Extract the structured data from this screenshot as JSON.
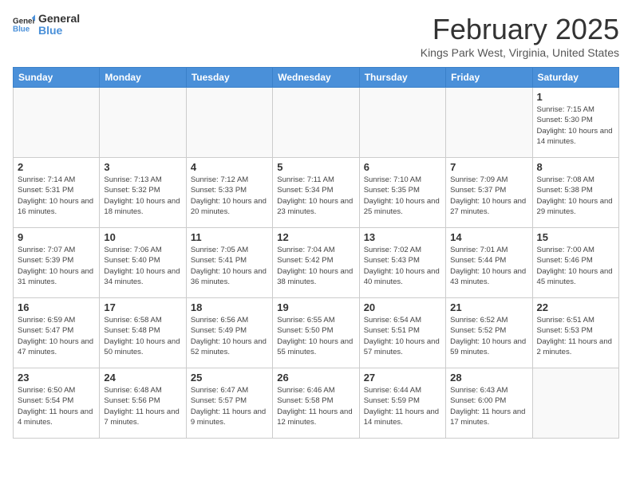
{
  "header": {
    "logo_line1": "General",
    "logo_line2": "Blue",
    "month_title": "February 2025",
    "location": "Kings Park West, Virginia, United States"
  },
  "weekdays": [
    "Sunday",
    "Monday",
    "Tuesday",
    "Wednesday",
    "Thursday",
    "Friday",
    "Saturday"
  ],
  "weeks": [
    [
      {
        "day": "",
        "info": ""
      },
      {
        "day": "",
        "info": ""
      },
      {
        "day": "",
        "info": ""
      },
      {
        "day": "",
        "info": ""
      },
      {
        "day": "",
        "info": ""
      },
      {
        "day": "",
        "info": ""
      },
      {
        "day": "1",
        "info": "Sunrise: 7:15 AM\nSunset: 5:30 PM\nDaylight: 10 hours and 14 minutes."
      }
    ],
    [
      {
        "day": "2",
        "info": "Sunrise: 7:14 AM\nSunset: 5:31 PM\nDaylight: 10 hours and 16 minutes."
      },
      {
        "day": "3",
        "info": "Sunrise: 7:13 AM\nSunset: 5:32 PM\nDaylight: 10 hours and 18 minutes."
      },
      {
        "day": "4",
        "info": "Sunrise: 7:12 AM\nSunset: 5:33 PM\nDaylight: 10 hours and 20 minutes."
      },
      {
        "day": "5",
        "info": "Sunrise: 7:11 AM\nSunset: 5:34 PM\nDaylight: 10 hours and 23 minutes."
      },
      {
        "day": "6",
        "info": "Sunrise: 7:10 AM\nSunset: 5:35 PM\nDaylight: 10 hours and 25 minutes."
      },
      {
        "day": "7",
        "info": "Sunrise: 7:09 AM\nSunset: 5:37 PM\nDaylight: 10 hours and 27 minutes."
      },
      {
        "day": "8",
        "info": "Sunrise: 7:08 AM\nSunset: 5:38 PM\nDaylight: 10 hours and 29 minutes."
      }
    ],
    [
      {
        "day": "9",
        "info": "Sunrise: 7:07 AM\nSunset: 5:39 PM\nDaylight: 10 hours and 31 minutes."
      },
      {
        "day": "10",
        "info": "Sunrise: 7:06 AM\nSunset: 5:40 PM\nDaylight: 10 hours and 34 minutes."
      },
      {
        "day": "11",
        "info": "Sunrise: 7:05 AM\nSunset: 5:41 PM\nDaylight: 10 hours and 36 minutes."
      },
      {
        "day": "12",
        "info": "Sunrise: 7:04 AM\nSunset: 5:42 PM\nDaylight: 10 hours and 38 minutes."
      },
      {
        "day": "13",
        "info": "Sunrise: 7:02 AM\nSunset: 5:43 PM\nDaylight: 10 hours and 40 minutes."
      },
      {
        "day": "14",
        "info": "Sunrise: 7:01 AM\nSunset: 5:44 PM\nDaylight: 10 hours and 43 minutes."
      },
      {
        "day": "15",
        "info": "Sunrise: 7:00 AM\nSunset: 5:46 PM\nDaylight: 10 hours and 45 minutes."
      }
    ],
    [
      {
        "day": "16",
        "info": "Sunrise: 6:59 AM\nSunset: 5:47 PM\nDaylight: 10 hours and 47 minutes."
      },
      {
        "day": "17",
        "info": "Sunrise: 6:58 AM\nSunset: 5:48 PM\nDaylight: 10 hours and 50 minutes."
      },
      {
        "day": "18",
        "info": "Sunrise: 6:56 AM\nSunset: 5:49 PM\nDaylight: 10 hours and 52 minutes."
      },
      {
        "day": "19",
        "info": "Sunrise: 6:55 AM\nSunset: 5:50 PM\nDaylight: 10 hours and 55 minutes."
      },
      {
        "day": "20",
        "info": "Sunrise: 6:54 AM\nSunset: 5:51 PM\nDaylight: 10 hours and 57 minutes."
      },
      {
        "day": "21",
        "info": "Sunrise: 6:52 AM\nSunset: 5:52 PM\nDaylight: 10 hours and 59 minutes."
      },
      {
        "day": "22",
        "info": "Sunrise: 6:51 AM\nSunset: 5:53 PM\nDaylight: 11 hours and 2 minutes."
      }
    ],
    [
      {
        "day": "23",
        "info": "Sunrise: 6:50 AM\nSunset: 5:54 PM\nDaylight: 11 hours and 4 minutes."
      },
      {
        "day": "24",
        "info": "Sunrise: 6:48 AM\nSunset: 5:56 PM\nDaylight: 11 hours and 7 minutes."
      },
      {
        "day": "25",
        "info": "Sunrise: 6:47 AM\nSunset: 5:57 PM\nDaylight: 11 hours and 9 minutes."
      },
      {
        "day": "26",
        "info": "Sunrise: 6:46 AM\nSunset: 5:58 PM\nDaylight: 11 hours and 12 minutes."
      },
      {
        "day": "27",
        "info": "Sunrise: 6:44 AM\nSunset: 5:59 PM\nDaylight: 11 hours and 14 minutes."
      },
      {
        "day": "28",
        "info": "Sunrise: 6:43 AM\nSunset: 6:00 PM\nDaylight: 11 hours and 17 minutes."
      },
      {
        "day": "",
        "info": ""
      }
    ]
  ]
}
